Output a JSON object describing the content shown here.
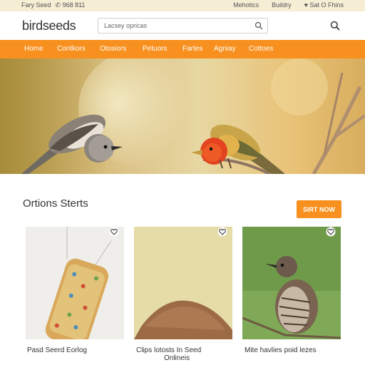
{
  "topbar": {
    "left_text": "Fary Seed",
    "phone": "✆ 968 811",
    "right_links": [
      "Mehotics",
      "Buildry",
      "♥ Sat O Fhins"
    ]
  },
  "header": {
    "logo": "birdseeds",
    "search_placeholder": "Lacsey opricas"
  },
  "nav": {
    "items": [
      "Home",
      "Contkors",
      "Otosiors",
      "Petuors",
      "Fartes",
      "Agniay",
      "Cottoes"
    ]
  },
  "section": {
    "title": "Ortions Sterts",
    "button": "SIRT NOW"
  },
  "products": [
    {
      "caption": "Pasd Seerd Eorlog",
      "icon": "heart-icon"
    },
    {
      "caption": "Clips lotosts In Seed",
      "caption2": "Onlineis",
      "icon": "heart-icon"
    },
    {
      "caption": "Mite havlies poid lezes",
      "icon": "heart-icon"
    }
  ],
  "colors": {
    "accent": "#f7901e",
    "topbar": "#f6edd5"
  }
}
